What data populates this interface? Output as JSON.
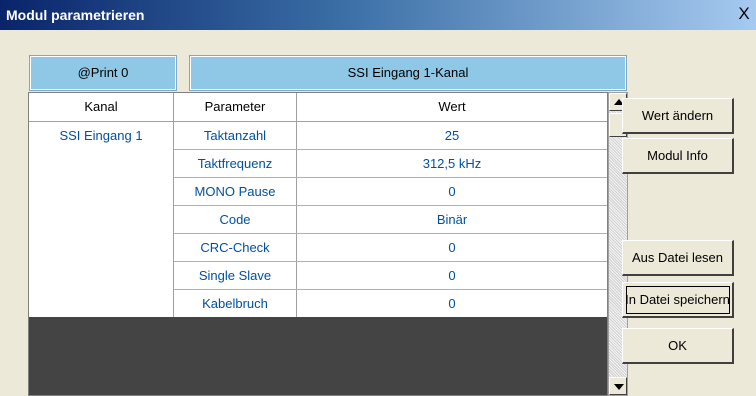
{
  "window": {
    "title": "Modul parametrieren",
    "close_glyph": "X"
  },
  "header": {
    "left": "@Print 0",
    "right": "SSI Eingang 1-Kanal"
  },
  "table": {
    "columns": [
      "Kanal",
      "Parameter",
      "Wert"
    ],
    "channel": "SSI Eingang 1",
    "rows": [
      {
        "parameter": "Taktanzahl",
        "value": "25"
      },
      {
        "parameter": "Taktfrequenz",
        "value": "312,5 kHz"
      },
      {
        "parameter": "MONO Pause",
        "value": "0"
      },
      {
        "parameter": "Code",
        "value": "Binär"
      },
      {
        "parameter": "CRC-Check",
        "value": "0"
      },
      {
        "parameter": "Single Slave",
        "value": "0"
      },
      {
        "parameter": "Kabelbruch",
        "value": "0"
      }
    ]
  },
  "buttons": {
    "wert_aendern": "Wert ändern",
    "modul_info": "Modul Info",
    "aus_datei_lesen": "Aus Datei lesen",
    "in_datei_speichern": "In Datei speichern",
    "ok": "OK"
  }
}
